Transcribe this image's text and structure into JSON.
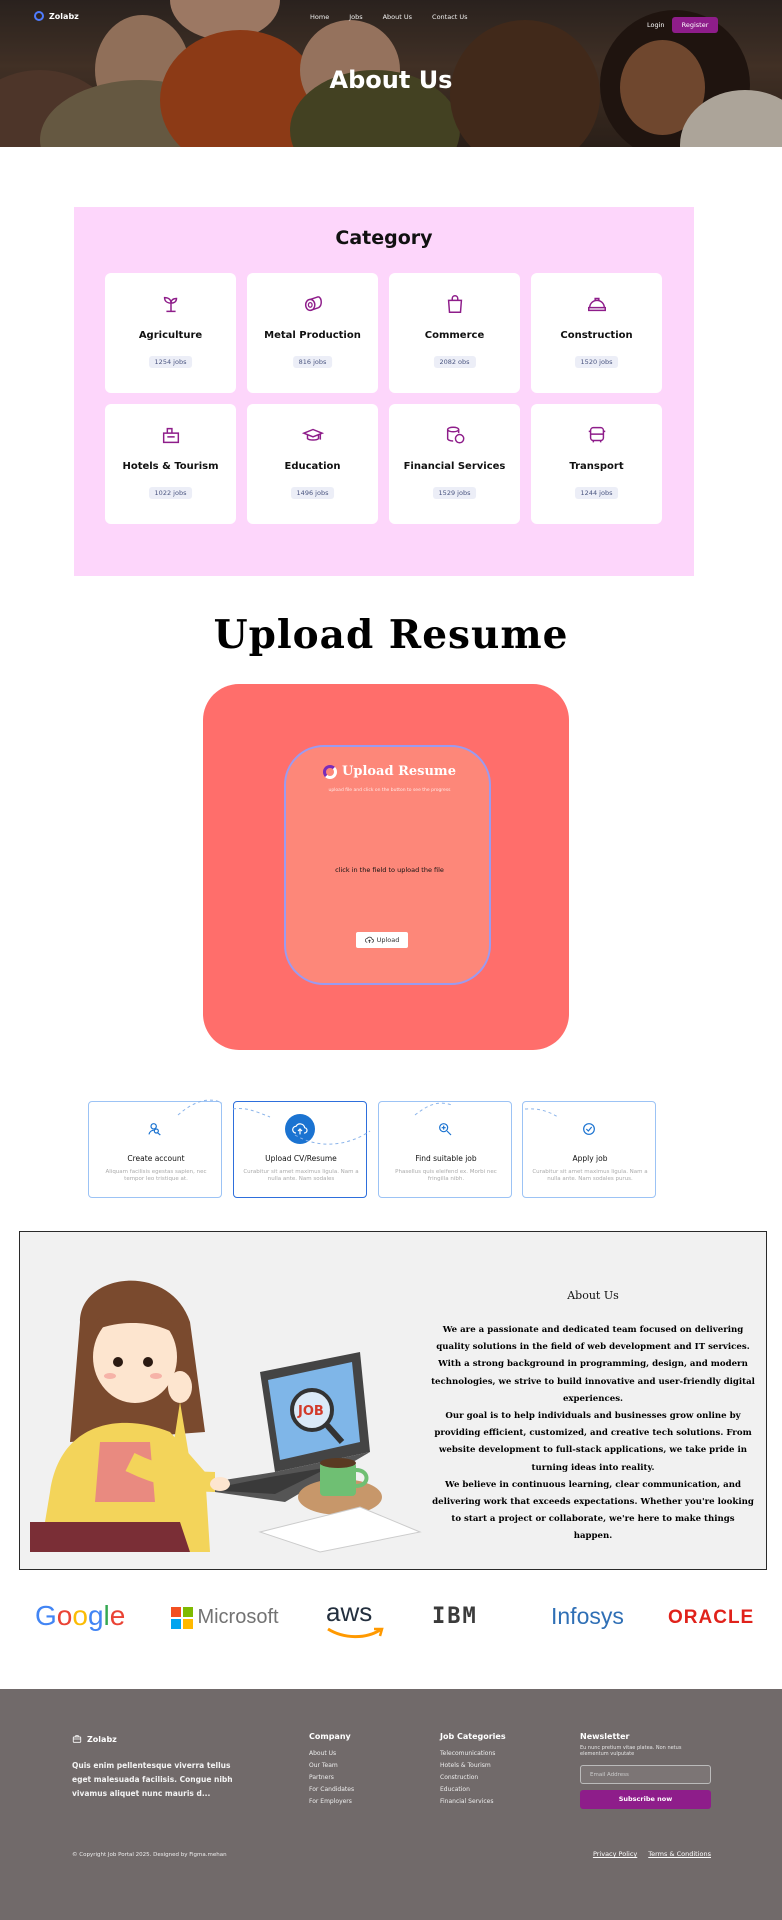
{
  "nav": {
    "brand": "Zolabz",
    "links": [
      "Home",
      "Jobs",
      "About Us",
      "Contact Us"
    ],
    "login": "Login",
    "register": "Register"
  },
  "hero": {
    "title": "About Us"
  },
  "category": {
    "title": "Category",
    "items": [
      {
        "name": "Agriculture",
        "jobs": "1254 jobs",
        "icon": "sprout-icon"
      },
      {
        "name": "Metal Production",
        "jobs": "816 jobs",
        "icon": "metal-roll-icon"
      },
      {
        "name": "Commerce",
        "jobs": "2082 obs",
        "icon": "shopping-bag-icon"
      },
      {
        "name": "Construction",
        "jobs": "1520 jobs",
        "icon": "hard-hat-icon"
      },
      {
        "name": "Hotels & Tourism",
        "jobs": "1022 jobs",
        "icon": "luggage-icon"
      },
      {
        "name": "Education",
        "jobs": "1496 jobs",
        "icon": "graduation-cap-icon"
      },
      {
        "name": "Financial Services",
        "jobs": "1529 jobs",
        "icon": "coins-icon"
      },
      {
        "name": "Transport",
        "jobs": "1244 jobs",
        "icon": "bus-icon"
      }
    ]
  },
  "upload": {
    "heading": "Upload Resume",
    "card_title": "Upload Resume",
    "card_subtitle": "upload file and click on the button to see the progress",
    "hint": "click in the field to upload the file",
    "button": "Upload"
  },
  "steps": [
    {
      "title": "Create account",
      "desc": "Aliquam facilisis egestas sapien, nec tempor leo tristique at.",
      "icon": "user-search-icon"
    },
    {
      "title": "Upload CV/Resume",
      "desc": "Curabitur sit amet maximus ligula. Nam a nulla ante. Nam sodales",
      "icon": "cloud-upload-icon"
    },
    {
      "title": "Find suitable job",
      "desc": "Phasellus quis eleifend ex. Morbi nec fringilla nibh.",
      "icon": "search-icon"
    },
    {
      "title": "Apply job",
      "desc": "Curabitur sit amet maximus ligula. Nam a nulla ante. Nam sodales purus.",
      "icon": "check-circle-icon"
    }
  ],
  "about": {
    "title": "About Us",
    "text": "We are a passionate and dedicated team focused on delivering quality solutions in the field of web development and IT services. With a strong background in programming, design, and modern technologies, we strive to build innovative and user-friendly digital experiences.\nOur goal is to help individuals and businesses grow online by providing efficient, customized, and creative tech solutions. From website development to full-stack applications, we take pride in turning ideas into reality.\nWe believe in continuous learning, clear communication, and delivering work that exceeds expectations. Whether you're looking to start a project or collaborate, we're here to make things happen."
  },
  "partners": [
    "Google",
    "Microsoft",
    "aws",
    "IBM",
    "Infosys",
    "ORACLE"
  ],
  "footer": {
    "brand": "Zolabz",
    "desc": "Quis enim pellentesque viverra tellus eget malesuada facilisis. Congue nibh vivamus aliquet nunc mauris d...",
    "company_title": "Company",
    "company_links": [
      "About Us",
      "Our Team",
      "Partners",
      "For Candidates",
      "For Employers"
    ],
    "categories_title": "Job Categories",
    "categories_links": [
      "Telecomunications",
      "Hotels & Tourism",
      "Construction",
      "Education",
      "Financial Services"
    ],
    "newsletter_title": "Newsletter",
    "newsletter_desc": "Eu nunc pretium vitae platea. Non netus elementum vulputate",
    "email_placeholder": "Email Address",
    "subscribe": "Subscribe now",
    "copyright": "© Copyright Job Portal 2025. Designed by Figma.mehan",
    "privacy": "Privacy Policy",
    "terms": "Terms & Conditions"
  }
}
